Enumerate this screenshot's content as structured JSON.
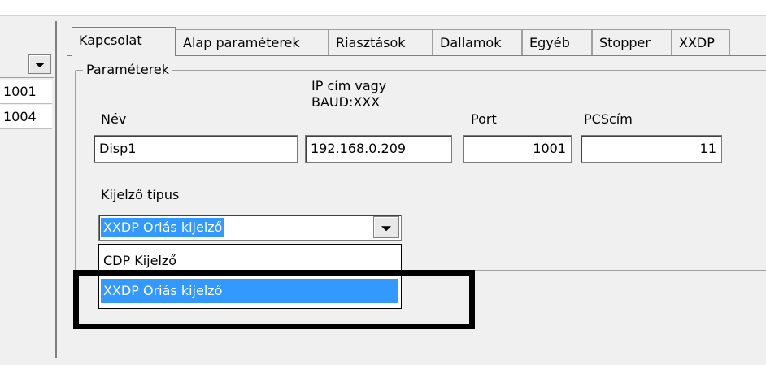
{
  "left_list": {
    "rows": [
      "1001",
      "1004"
    ]
  },
  "tabs": [
    "Kapcsolat",
    "Alap paraméterek",
    "Riasztások",
    "Dallamok",
    "Egyéb",
    "Stopper",
    "XXDP"
  ],
  "group": {
    "title": "Paraméterek",
    "name_label": "Név",
    "ip_label_line1": "IP cím vagy",
    "ip_label_line2": "BAUD:XXX",
    "port_label": "Port",
    "pcs_label": "PCScím",
    "name_value": "Disp1",
    "ip_value": "192.168.0.209",
    "port_value": "1001",
    "pcs_value": "11",
    "display_type_label": "Kijelző típus",
    "display_type_value": "XXDP Oriás kijelző",
    "options": [
      "CDP Kijelző",
      "XXDP Oriás kijelző"
    ],
    "selected_option": "XXDP Oriás kijelző"
  },
  "colors": {
    "selection": "#3399ff",
    "highlight_box": "#000000"
  }
}
